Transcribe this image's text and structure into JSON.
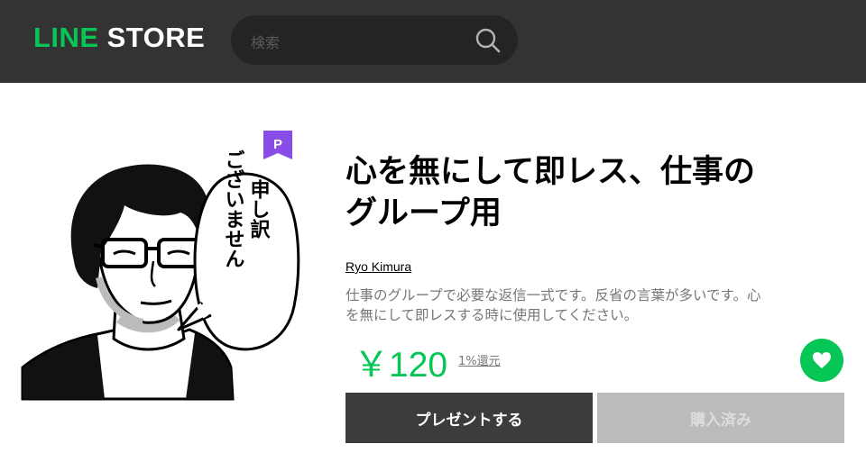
{
  "header": {
    "logo_line": "LINE",
    "logo_store": "STORE",
    "search_placeholder": "検索",
    "search_icon": "search-icon"
  },
  "product": {
    "badge": "P",
    "title_line1": "心を無にして即レス、仕事の",
    "title_line2": "グループ用",
    "author": "Ryo Kimura",
    "description_line1": "仕事のグループで必要な返信一式です。反省の言葉が多いです。心",
    "description_line2": "を無にして即レスする時に使用してください。",
    "price": "￥120",
    "points": "1%還元",
    "favorite_icon": "heart-icon",
    "art_speech": [
      "申し訳",
      "ございません"
    ]
  },
  "actions": {
    "present_label": "プレゼントする",
    "owned_label": "購入済み"
  },
  "colors": {
    "brand_green": "#06c755",
    "header_bg": "#333333",
    "premium_purple": "#8a4ce6"
  }
}
